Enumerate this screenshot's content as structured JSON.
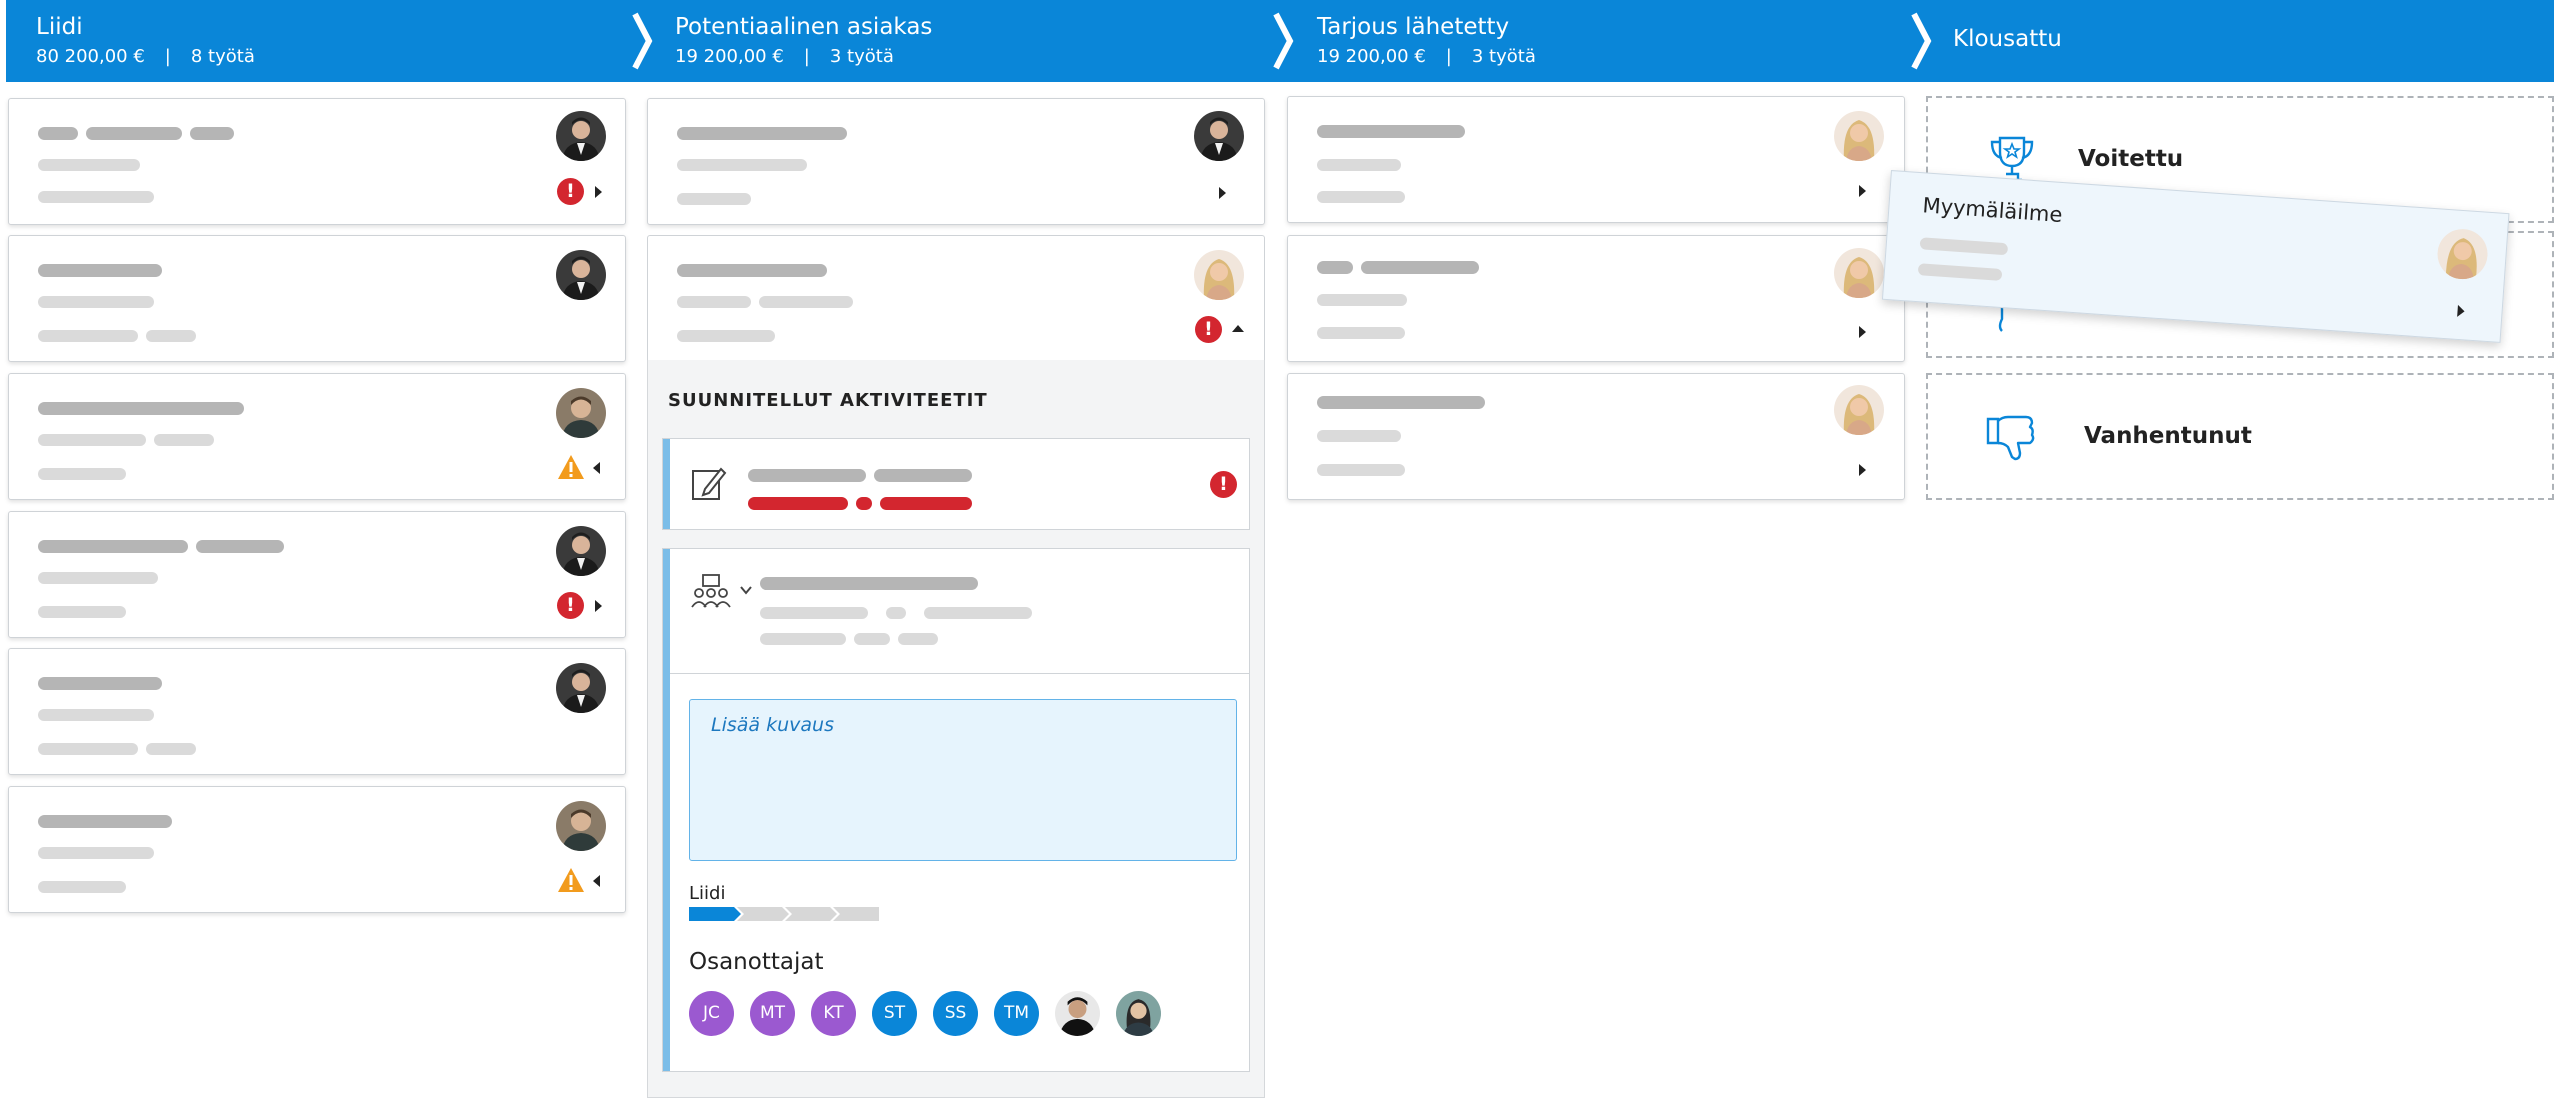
{
  "pipeline": {
    "stages": [
      {
        "title": "Liidi",
        "amount": "80 200,00 €",
        "separator": "|",
        "count": "8 työtä"
      },
      {
        "title": "Potentiaalinen asiakas",
        "amount": "19 200,00 €",
        "separator": "|",
        "count": "3 työtä"
      },
      {
        "title": "Tarjous lähetetty",
        "amount": "19 200,00 €",
        "separator": "|",
        "count": "3 työtä"
      },
      {
        "title": "Klousattu"
      }
    ]
  },
  "expanded": {
    "section_title": "SUUNNITELLUT AKTIVITEETIT",
    "description_placeholder": "Lisää kuvaus",
    "stage_label": "Liidi",
    "stage_progress": 0.25,
    "participants_title": "Osanottajat",
    "participants": [
      {
        "initials": "JC",
        "color": "#9b59d0"
      },
      {
        "initials": "MT",
        "color": "#9b59d0"
      },
      {
        "initials": "KT",
        "color": "#9b59d0"
      },
      {
        "initials": "ST",
        "color": "#0a86d8"
      },
      {
        "initials": "SS",
        "color": "#0a86d8"
      },
      {
        "initials": "TM",
        "color": "#0a86d8"
      }
    ]
  },
  "closed": {
    "won_label": "Voitettu",
    "expired_label": "Vanhentunut"
  },
  "dragging_card": {
    "title": "Myymäläilme"
  },
  "colors": {
    "header": "#0a86d8",
    "alert": "#d3262f",
    "warning": "#f29b1d",
    "accent": "#0a86d8"
  }
}
